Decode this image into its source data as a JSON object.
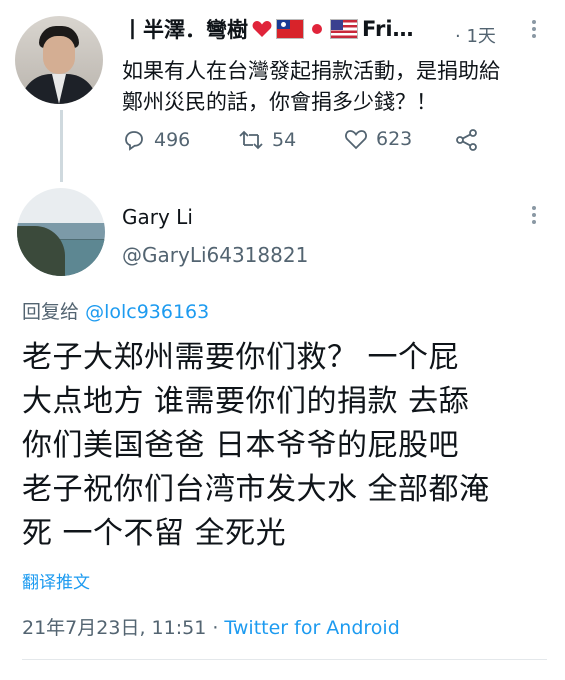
{
  "parent_tweet": {
    "author_name": "丨半澤．彎樹",
    "author_suffix": "Fri…",
    "timestamp": "· 1天",
    "text_lines": [
      "如果有人在台灣發起捐款活動，是捐助給",
      "鄭州災民的話，你會捐多少錢？！"
    ],
    "actions": {
      "reply_count": "496",
      "retweet_count": "54",
      "like_count": "623"
    },
    "name_emoji": [
      "heart-icon",
      "taiwan-flag-icon",
      "red-dot-icon",
      "us-flag-icon"
    ]
  },
  "reply_tweet": {
    "author_name": "Gary Li",
    "author_handle": "@GaryLi64318821",
    "replying_label": "回复给",
    "replying_to": "@lolc936163",
    "body_lines": [
      "老子大郑州需要你们救？  一个屁",
      "大点地方  谁需要你们的捐款  去舔",
      "你们美国爸爸 日本爷爷的屁股吧",
      "老子祝你们台湾市发大水 全部都淹",
      "死  一个不留  全死光"
    ],
    "translate_label": "翻译推文",
    "date_time": "21年7月23日, 11:51",
    "separator": "·",
    "source": "Twitter for Android"
  },
  "colors": {
    "link": "#1d9bf0",
    "secondary_text": "#536471",
    "primary_text": "#0f1419",
    "thread_line": "#cfd9de"
  }
}
